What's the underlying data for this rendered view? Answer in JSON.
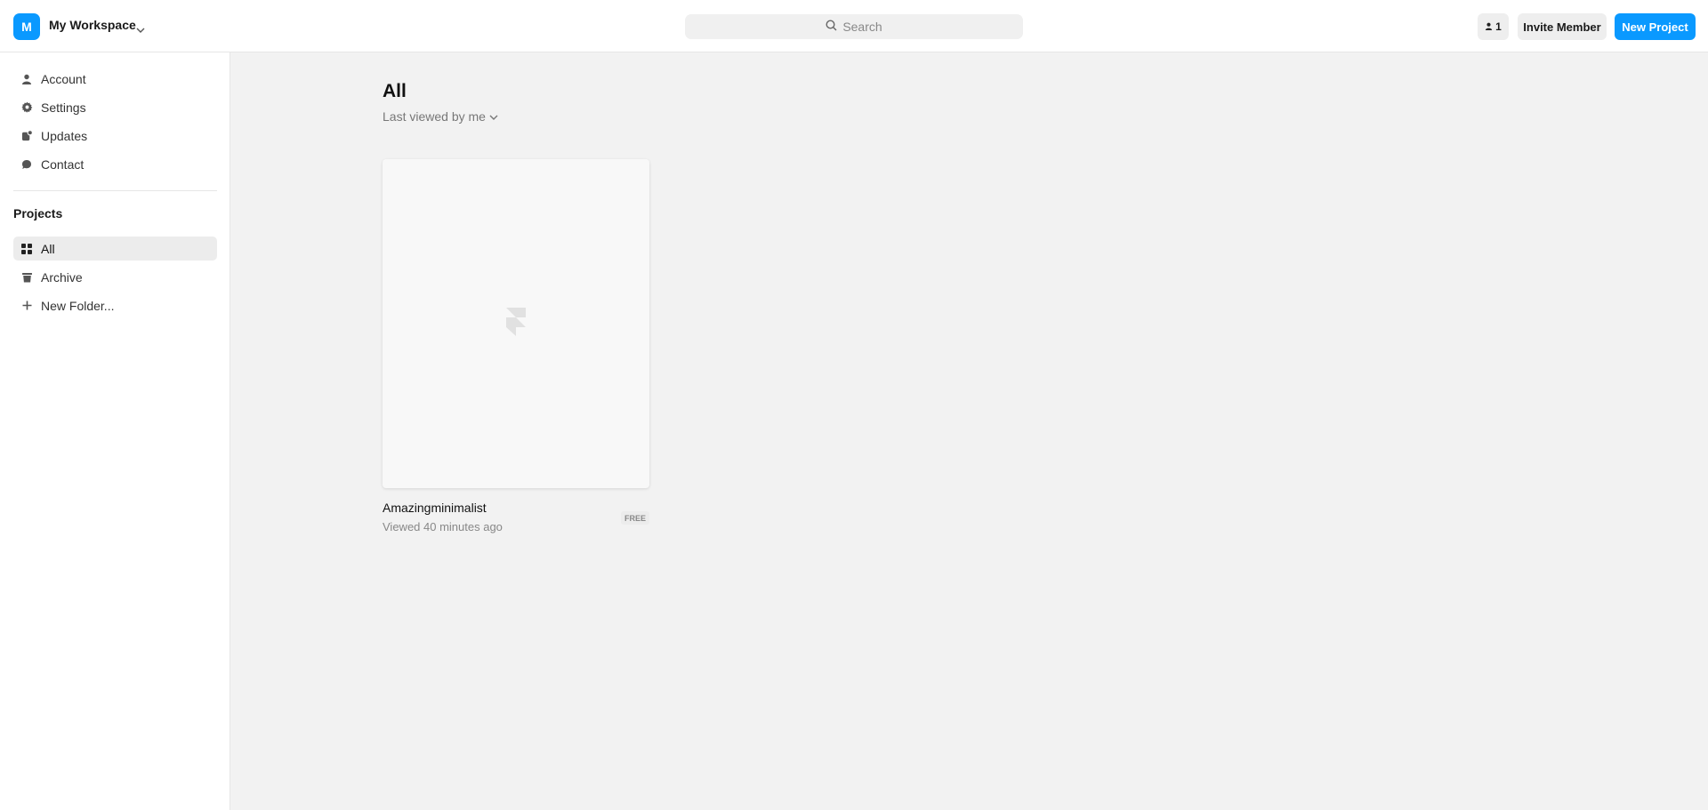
{
  "header": {
    "workspace_initial": "M",
    "workspace_name": "My Workspace",
    "search_placeholder": "Search",
    "member_count": "1",
    "invite_label": "Invite Member",
    "new_project_label": "New Project",
    "accent_color": "#0a99ff"
  },
  "sidebar": {
    "items": [
      {
        "label": "Account",
        "icon": "person-icon"
      },
      {
        "label": "Settings",
        "icon": "gear-icon"
      },
      {
        "label": "Updates",
        "icon": "updates-icon"
      },
      {
        "label": "Contact",
        "icon": "chat-bubble-icon"
      }
    ],
    "projects_title": "Projects",
    "project_items": [
      {
        "label": "All",
        "icon": "grid-icon",
        "active": true
      },
      {
        "label": "Archive",
        "icon": "trash-icon"
      },
      {
        "label": "New Folder...",
        "icon": "plus-icon"
      }
    ]
  },
  "main": {
    "title": "All",
    "sort_label": "Last viewed by me",
    "projects": [
      {
        "name": "Amazingminimalist",
        "meta": "Viewed 40 minutes ago",
        "badge": "FREE"
      }
    ]
  }
}
